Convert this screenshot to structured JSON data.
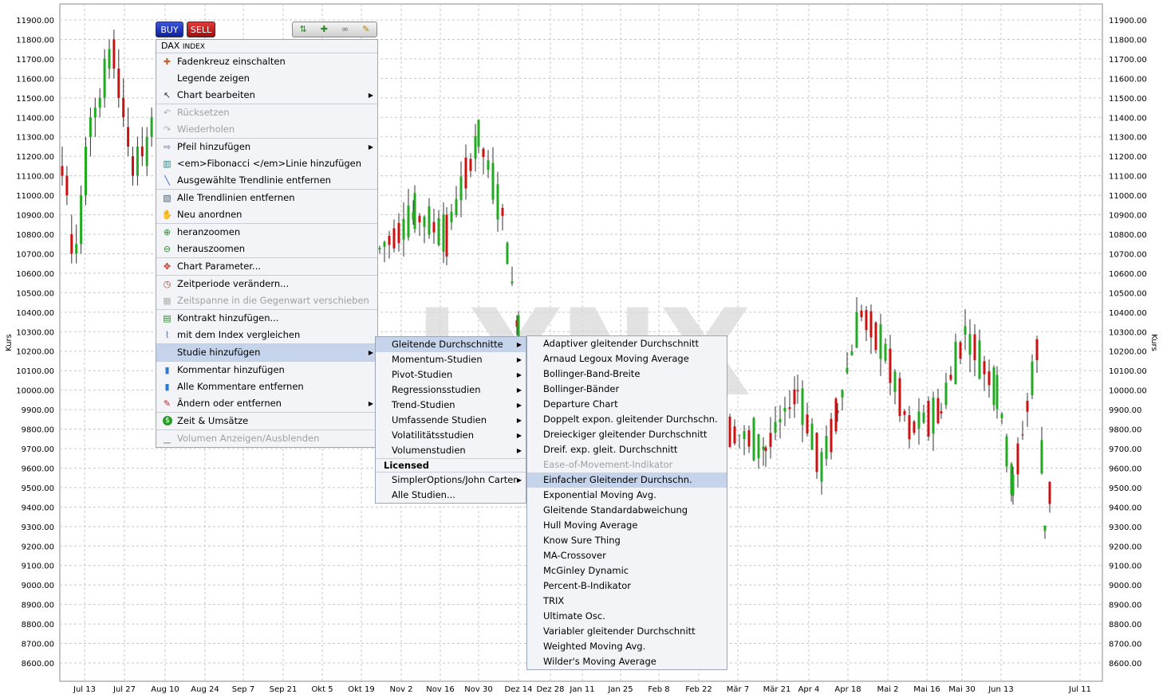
{
  "toolbar": {
    "buy_label": "BUY",
    "sell_label": "SELL",
    "tools": [
      "trend-tool-icon",
      "add-study-icon",
      "link-icon",
      "clear-icon"
    ]
  },
  "context_menu": {
    "header_main": "DAX",
    "header_sub": "INDEX",
    "items": [
      {
        "label": "Fadenkreuz einschalten",
        "icon": "crosshair-icon",
        "disabled": false
      },
      {
        "label": "Legende zeigen",
        "icon": "",
        "disabled": false
      },
      {
        "label": "Chart bearbeiten",
        "icon": "edit-chart-icon",
        "disabled": false,
        "submenu": true
      },
      {
        "label": "Rücksetzen",
        "icon": "undo-icon",
        "disabled": true
      },
      {
        "label": "Wiederholen",
        "icon": "redo-icon",
        "disabled": true
      },
      {
        "label": "Pfeil hinzufügen",
        "icon": "arrow-icon",
        "disabled": false,
        "submenu": true
      },
      {
        "label": "<em>Fibonacci </em>Linie hinzufügen",
        "icon": "fibonacci-icon",
        "disabled": false
      },
      {
        "label": "Ausgewählte Trendlinie entfernen",
        "icon": "remove-trendline-icon",
        "disabled": false
      },
      {
        "label": "Alle Trendlinien entfernen",
        "icon": "remove-all-trendlines-icon",
        "disabled": false
      },
      {
        "label": "Neu anordnen",
        "icon": "hand-icon",
        "disabled": false
      },
      {
        "label": "heranzoomen",
        "icon": "zoom-in-icon",
        "disabled": false
      },
      {
        "label": "herauszoomen",
        "icon": "zoom-out-icon",
        "disabled": false
      },
      {
        "label": "Chart Parameter...",
        "icon": "parameters-icon",
        "disabled": false
      },
      {
        "label": "Zeitperiode verändern...",
        "icon": "clock-icon",
        "disabled": false
      },
      {
        "label": "Zeitspanne in die Gegenwart verschieben",
        "icon": "shift-icon",
        "disabled": true
      },
      {
        "label": "Kontrakt hinzufügen...",
        "icon": "add-contract-icon",
        "disabled": false
      },
      {
        "label": "mit dem Index vergleichen",
        "icon": "compare-icon",
        "disabled": false
      },
      {
        "label": "Studie hinzufügen",
        "icon": "",
        "disabled": false,
        "submenu": true
      },
      {
        "label": "Kommentar hinzufügen",
        "icon": "comment-icon",
        "disabled": false
      },
      {
        "label": "Alle Kommentare entfernen",
        "icon": "remove-comments-icon",
        "disabled": false
      },
      {
        "label": "Ändern oder entfernen",
        "icon": "pencil-icon",
        "disabled": false,
        "submenu": true
      },
      {
        "label": "Zeit & Umsätze",
        "icon": "dollar-icon",
        "disabled": false
      },
      {
        "label": "Volumen Anzeigen/Ausblenden",
        "icon": "volume-icon",
        "disabled": true
      }
    ]
  },
  "studies_menu": {
    "items": [
      "Gleitende Durchschnitte",
      "Momentum-Studien",
      "Pivot-Studien",
      "Regressionsstudien",
      "Trend-Studien",
      "Umfassende Studien",
      "Volatilitätsstudien",
      "Volumenstudien"
    ],
    "licensed_label": "Licensed",
    "licensed_items": [
      "SimplerOptions/John Carter"
    ],
    "all_label": "Alle Studien..."
  },
  "ma_menu": {
    "items": [
      "Adaptiver gleitender Durchschnitt",
      "Arnaud Legoux Moving Average",
      "Bollinger-Band-Breite",
      "Bollinger-Bänder",
      "Departure Chart",
      "Doppelt expon. gleitender Durchschn.",
      "Dreieckiger gleitender Durchschnitt",
      "Dreif. exp. gleit. Durchschnitt",
      "Ease-of-Movement-Indikator",
      "Einfacher Gleitender Durchschn.",
      "Exponential Moving Avg.",
      "Gleitende Standardabweichung",
      "Hull Moving Average",
      "Know Sure Thing",
      "MA-Crossover",
      "McGinley Dynamic",
      "Percent-B-Indikator",
      "TRIX",
      "Ultimate Osc.",
      "Variabler gleitender Durchschnitt",
      "Weighted Moving Avg.",
      "Wilder's Moving Average"
    ],
    "disabled_index": 8,
    "highlight_index": 9
  },
  "chart_data": {
    "type": "candlestick",
    "ylabel": "Kurs",
    "ylim": [
      8550,
      11950
    ],
    "y_ticks": [
      "11900.00",
      "11800.00",
      "11700.00",
      "11600.00",
      "11500.00",
      "11400.00",
      "11300.00",
      "11200.00",
      "11100.00",
      "11000.00",
      "10900.00",
      "10800.00",
      "10700.00",
      "10600.00",
      "10500.00",
      "10400.00",
      "10300.00",
      "10200.00",
      "10100.00",
      "10000.00",
      "9900.00",
      "9800.00",
      "9700.00",
      "9600.00",
      "9500.00",
      "9400.00",
      "9300.00",
      "9200.00",
      "9100.00",
      "9000.00",
      "8900.00",
      "8800.00",
      "8700.00",
      "8600.00"
    ],
    "x_ticks": [
      "Jul 13",
      "Jul 27",
      "Aug 10",
      "Aug 24",
      "Sep 7",
      "Sep 21",
      "Okt 5",
      "Okt 19",
      "Nov 2",
      "Nov 16",
      "Nov 30",
      "Dez 14",
      "Dez 28",
      "Jan 11",
      "Jan 25",
      "Feb 8",
      "Feb 22",
      "Mär 7",
      "Mär 21",
      "Apr 4",
      "Apr 18",
      "Mai 2",
      "Mai 16",
      "Mai 30",
      "Jun 13",
      "Jul 11"
    ],
    "watermark": "LYNX",
    "grid": true,
    "colors": {
      "up": "#22aa22",
      "down": "#cc1111"
    },
    "candles": [
      [
        11150,
        11250,
        11050,
        11100
      ],
      [
        11100,
        11150,
        10950,
        11000
      ],
      [
        10800,
        10900,
        10650,
        10700
      ],
      [
        10700,
        10850,
        10650,
        10750
      ],
      [
        10750,
        11050,
        10700,
        11000
      ],
      [
        11000,
        11300,
        10950,
        11250
      ],
      [
        11300,
        11450,
        11200,
        11400
      ],
      [
        11400,
        11500,
        11300,
        11450
      ],
      [
        11450,
        11550,
        11400,
        11500
      ],
      [
        11500,
        11750,
        11450,
        11700
      ],
      [
        11650,
        11800,
        11600,
        11750
      ],
      [
        11800,
        11850,
        11600,
        11650
      ],
      [
        11650,
        11750,
        11450,
        11500
      ],
      [
        11500,
        11600,
        11350,
        11400
      ],
      [
        11350,
        11450,
        11200,
        11250
      ],
      [
        11200,
        11250,
        11050,
        11100
      ],
      [
        11100,
        11300,
        11050,
        11250
      ],
      [
        11250,
        11350,
        11150,
        11200
      ],
      [
        11150,
        11350,
        11100,
        11300
      ],
      [
        11300,
        11450,
        11250,
        11400
      ]
    ]
  }
}
